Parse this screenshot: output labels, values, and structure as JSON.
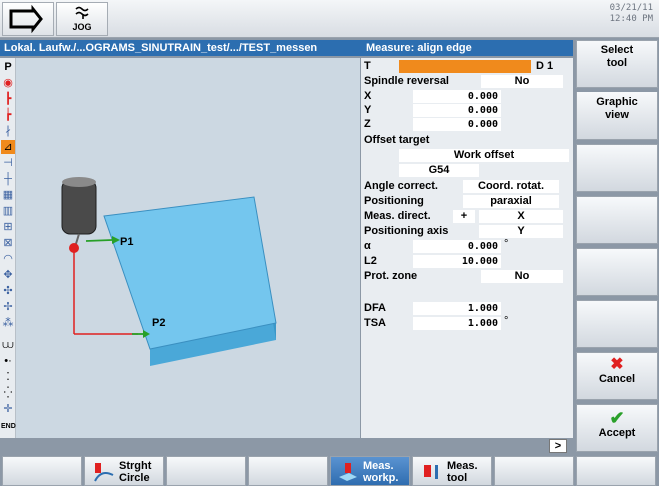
{
  "topbar": {
    "jog_label": "JOG",
    "date": "03/21/11",
    "time": "12:40 PM"
  },
  "titlebar": {
    "path": "Lokal. Laufw./...OGRAMS_SINUTRAIN_test/.../TEST_messen",
    "measure_title": "Measure: align edge"
  },
  "graphic": {
    "p1_label": "P1",
    "p2_label": "P2"
  },
  "left_icons": [
    "P"
  ],
  "params": {
    "t": {
      "label": "T",
      "value": "",
      "d_label": "D 1"
    },
    "spindle": {
      "label": "Spindle reversal",
      "value": "No"
    },
    "x": {
      "label": "X",
      "value": "0.000"
    },
    "y": {
      "label": "Y",
      "value": "0.000"
    },
    "z": {
      "label": "Z",
      "value": "0.000"
    },
    "offset_target": {
      "label": "Offset target",
      "value": "Work offset",
      "wo": "G54"
    },
    "angle_correct": {
      "label": "Angle correct.",
      "value": "Coord. rotat."
    },
    "positioning": {
      "label": "Positioning",
      "value": "paraxial"
    },
    "meas_direct": {
      "label": "Meas. direct.",
      "sign": "+",
      "value": "X"
    },
    "positioning_axis": {
      "label": "Positioning axis",
      "value": "Y"
    },
    "alpha": {
      "label": "α",
      "value": "0.000",
      "unit": "°"
    },
    "l2": {
      "label": "L2",
      "value": "10.000"
    },
    "prot_zone": {
      "label": "Prot. zone",
      "value": "No"
    },
    "dfa": {
      "label": "DFA",
      "value": "1.000"
    },
    "tsa": {
      "label": "TSA",
      "value": "1.000",
      "unit": "°"
    }
  },
  "right_softkeys": {
    "select_tool": "Select tool",
    "graphic_view": "Graphic view",
    "cancel": "Cancel",
    "accept": "Accept"
  },
  "statusbar": {
    "scroll_symbol": ">"
  },
  "bottom_softkeys": {
    "stright_circle": "Strght Circle",
    "meas_workp": "Meas. workp.",
    "meas_tool": "Meas. tool"
  },
  "colors": {
    "title": "#2c6eb0",
    "accent": "#f08a1c",
    "block": "#6ec3ea",
    "cancel": "#e02020",
    "accept": "#2aa02a"
  }
}
